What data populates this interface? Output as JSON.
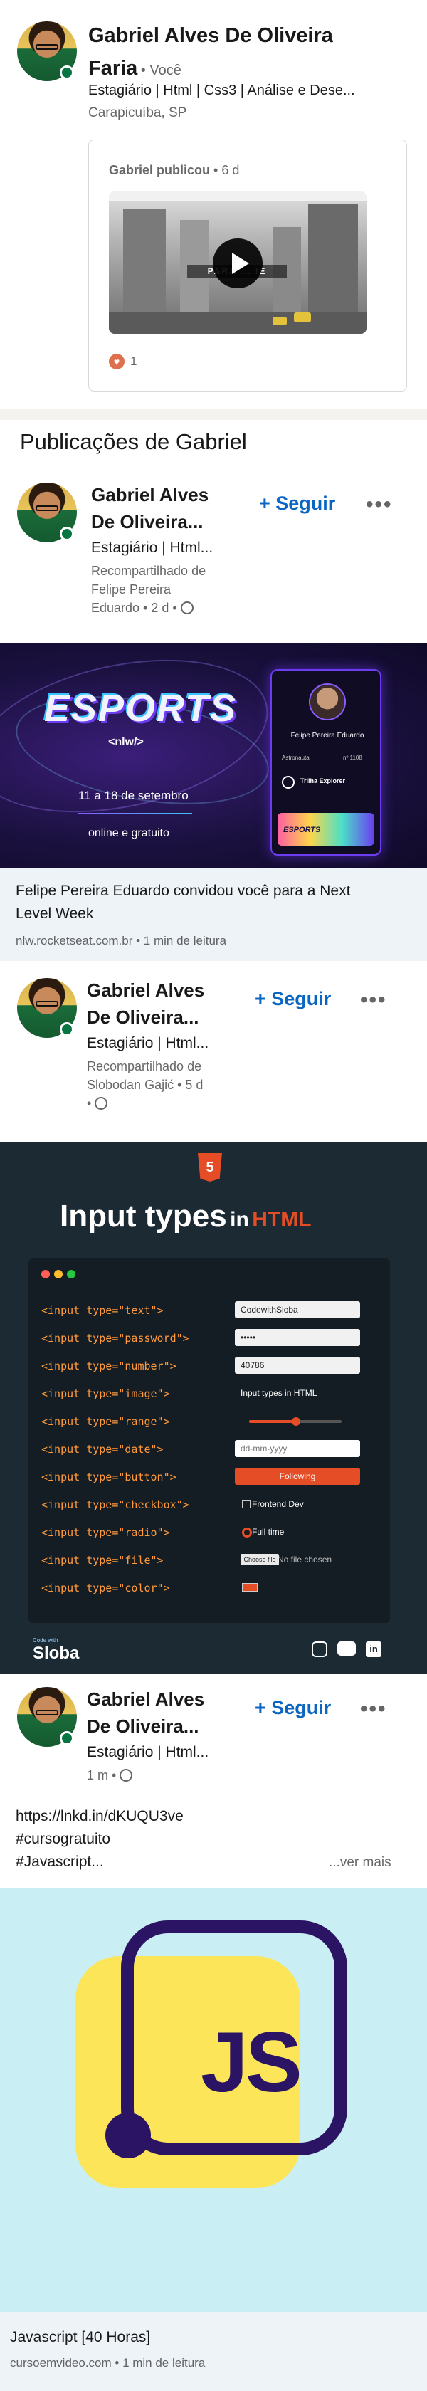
{
  "profile": {
    "name_line1": "Gabriel Alves De Oliveira",
    "name_line2": "Faria",
    "you_label": "• Você",
    "headline": "Estagiário | Html | Css3 | Análise e Dese...",
    "location": "Carapicuíba, SP"
  },
  "activity_card": {
    "author_text": "Gabriel publicou",
    "age": "• 6 d",
    "video_overlay_text": "PARA ... IE",
    "reactions_count": "1"
  },
  "posts_section": {
    "title": "Publicações de Gabriel"
  },
  "posts": [
    {
      "author_line1": "Gabriel Alves",
      "author_line2": "De Oliveira...",
      "headline": "Estagiário | Html...",
      "meta1": "Recompartilhado de",
      "meta2": "Felipe Pereira",
      "meta3": "Eduardo • 2 d •",
      "follow_label": "+ Seguir",
      "more_label": "•••",
      "image": {
        "logo": "ESPORTS",
        "logo_sub": "<nlw/>",
        "dates": "11 a 18 de setembro",
        "online": "online e gratuito",
        "card_name": "Felipe Pereira Eduardo",
        "card_role": "Astronauta",
        "card_no": "nº 1108",
        "card_track": "Trilha Explorer",
        "card_logo": "ESPORTS"
      },
      "link_title_line1": "Felipe Pereira Eduardo convidou você para a Next",
      "link_title_line2": "Level Week",
      "link_meta": "nlw.rocketseat.com.br • 1 min de leitura"
    },
    {
      "author_line1": "Gabriel Alves",
      "author_line2": "De Oliveira...",
      "headline": "Estagiário | Html...",
      "meta1": "Recompartilhado de",
      "meta2": "Slobodan Gajić • 5 d",
      "meta3": "•",
      "follow_label": "+ Seguir",
      "more_label": "•••",
      "image": {
        "badge": "5",
        "title_main": "Input types",
        "title_in": "in",
        "title_html": "HTML",
        "brand": "Sloba",
        "brand_small": "Code with",
        "rows": [
          {
            "code": "<input type=\"text\">",
            "preview": "CodewithSloba"
          },
          {
            "code": "<input type=\"password\">",
            "preview": "•••••"
          },
          {
            "code": "<input type=\"number\">",
            "preview": "40786"
          },
          {
            "code": "<input type=\"image\">",
            "preview": "Input types in HTML"
          },
          {
            "code": "<input type=\"range\">",
            "preview": ""
          },
          {
            "code": "<input type=\"date\">",
            "preview": "dd-mm-yyyy"
          },
          {
            "code": "<input type=\"button\">",
            "preview": "Following"
          },
          {
            "code": "<input type=\"checkbox\">",
            "preview": "Frontend Dev"
          },
          {
            "code": "<input type=\"radio\">",
            "preview": "Full time"
          },
          {
            "code": "<input type=\"file\">",
            "preview": "No file chosen"
          },
          {
            "code": "<input type=\"color\">",
            "preview": ""
          }
        ],
        "choose_file": "Choose file"
      }
    },
    {
      "author_line1": "Gabriel Alves",
      "author_line2": "De Oliveira...",
      "headline": "Estagiário | Html...",
      "meta1": "1 m •",
      "follow_label": "+ Seguir",
      "more_label": "•••",
      "text_line1": "https://lnkd.in/dKUQU3ve",
      "text_line2": "#cursogratuito",
      "text_line3": "#Javascript...",
      "see_more": "...ver mais",
      "image": {
        "logo_text": "JS"
      },
      "link_title": "Javascript [40 Horas]",
      "link_meta": "cursoemvideo.com • 1 min de leitura"
    }
  ],
  "colors": {
    "linkedin_blue": "#0a66c2",
    "online_green": "#057642",
    "page_bg": "#f3f2ef",
    "link_bg": "#eef3f8",
    "html_orange": "#e44d26",
    "js_yellow": "#fde55a",
    "js_purple": "#2b1463",
    "js_bg": "#c9eef3"
  }
}
